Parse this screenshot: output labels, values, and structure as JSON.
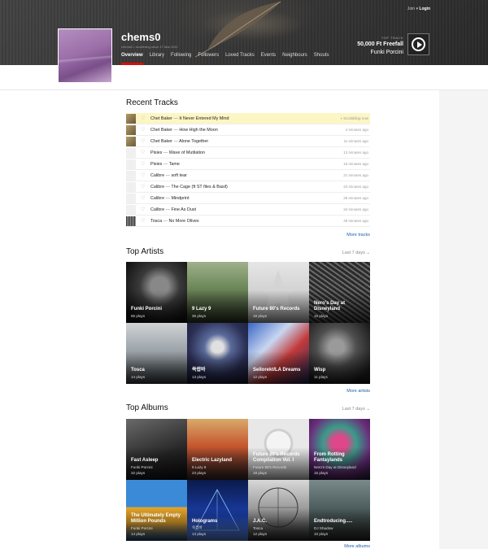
{
  "header": {
    "join_label": "Join",
    "login_label": "Login",
    "username": "chems0",
    "since": "chems0 • scrobbling since 17 Mar 2011",
    "nav": [
      "Overview",
      "Library",
      "Following",
      "Followers",
      "Loved Tracks",
      "Events",
      "Neighbours",
      "Shouts"
    ],
    "top_track_label": "TOP TRACK",
    "top_track_title": "50,000 Ft Freefall",
    "top_track_artist": "Funki Porcini"
  },
  "recent_tracks": {
    "heading": "Recent Tracks",
    "separator": "—",
    "items": [
      {
        "artist": "Chet Baker",
        "title": "It Never Entered My Mind",
        "time": "Scrobbling now"
      },
      {
        "artist": "Chet Baker",
        "title": "How High the Moon",
        "time": "4 minutes ago"
      },
      {
        "artist": "Chet Baker",
        "title": "Alone Together",
        "time": "11 minutes ago"
      },
      {
        "artist": "Pixies",
        "title": "Wave of Mutilation",
        "time": "13 minutes ago"
      },
      {
        "artist": "Pixies",
        "title": "Tame",
        "time": "16 minutes ago"
      },
      {
        "artist": "Calibre",
        "title": "soft tear",
        "time": "21 minutes ago"
      },
      {
        "artist": "Calibre",
        "title": "The Cage (ft ST files & Basil)",
        "time": "23 minutes ago"
      },
      {
        "artist": "Calibre",
        "title": "Mindprint",
        "time": "29 minutes ago"
      },
      {
        "artist": "Calibre",
        "title": "Fine As Dust",
        "time": "34 minutes ago"
      },
      {
        "artist": "Tosca",
        "title": "No More Olives",
        "time": "48 minutes ago"
      }
    ],
    "more_label": "More tracks"
  },
  "top_artists": {
    "heading": "Top Artists",
    "period": "Last 7 days",
    "items": [
      {
        "name": "Funki Porcini",
        "plays": "86 plays"
      },
      {
        "name": "9 Lazy 9",
        "plays": "35 plays"
      },
      {
        "name": "Future 80's Records",
        "plays": "18 plays"
      },
      {
        "name": "Nero's Day at Disneyland",
        "plays": "16 plays"
      },
      {
        "name": "Tosca",
        "plays": "14 plays"
      },
      {
        "name": "쑥쌉바",
        "plays": "13 plays"
      },
      {
        "name": "Sellorekt/LA Dreams",
        "plays": "12 plays"
      },
      {
        "name": "Wisp",
        "plays": "11 plays"
      }
    ],
    "more_label": "More artists"
  },
  "top_albums": {
    "heading": "Top Albums",
    "period": "Last 7 days",
    "items": [
      {
        "title": "Fast Asleep",
        "artist": "Funki Porcini",
        "plays": "32 plays"
      },
      {
        "title": "Electric Lazyland",
        "artist": "9 Lazy 9",
        "plays": "23 plays"
      },
      {
        "title": "Future 80's Records Compilation Vol. I",
        "artist": "Future 80's Records",
        "plays": "18 plays"
      },
      {
        "title": "From Rotting Fantaylands",
        "artist": "Nero's Day at Disneyland",
        "plays": "15 plays"
      },
      {
        "title": "The Ultimately Empty Million Pounds",
        "artist": "Funki Porcini",
        "plays": "14 plays"
      },
      {
        "title": "Holograms",
        "artist": "쑥쌉바",
        "plays": "13 plays"
      },
      {
        "title": "J.A.C.",
        "artist": "Tosca",
        "plays": "12 plays"
      },
      {
        "title": "Endtroducing.....",
        "artist": "DJ Shadow",
        "plays": "10 plays"
      }
    ],
    "more_label": "More albums"
  }
}
